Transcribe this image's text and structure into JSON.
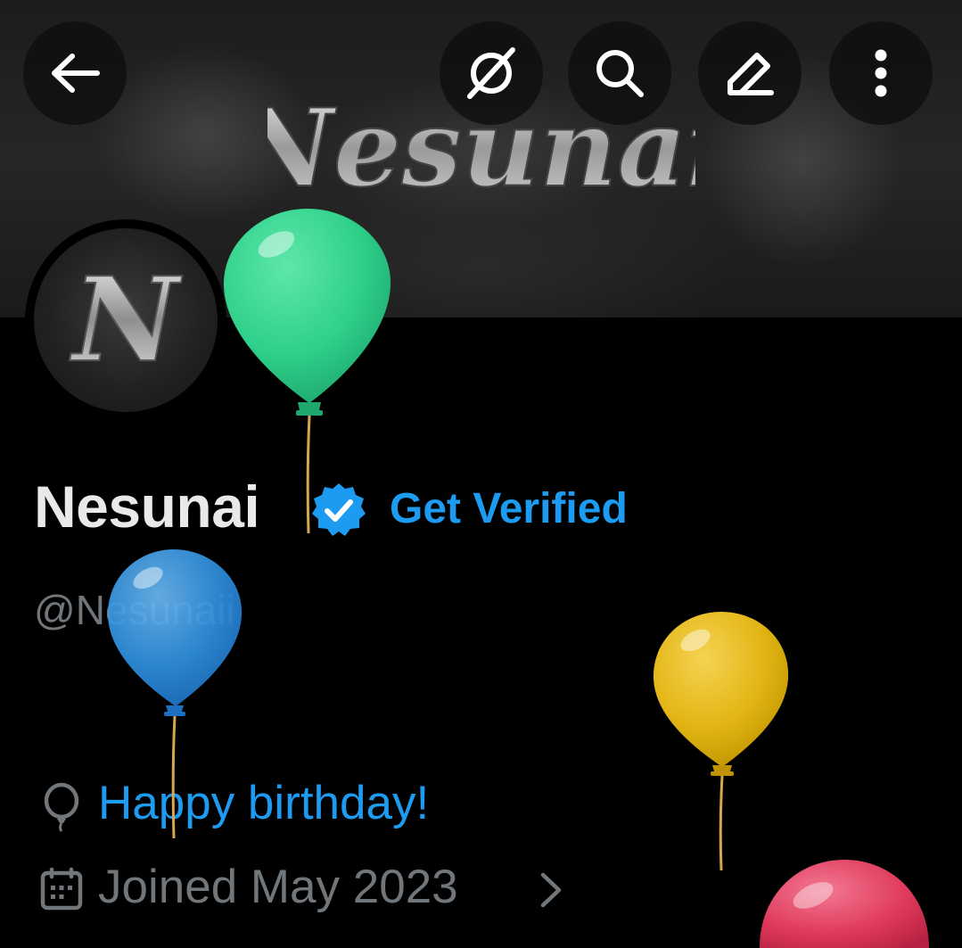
{
  "header": {
    "back_icon": "arrow-left-icon",
    "buttons": [
      {
        "icon": "grok-icon"
      },
      {
        "icon": "search-icon"
      },
      {
        "icon": "edit-icon"
      },
      {
        "icon": "more-vertical-icon"
      }
    ]
  },
  "banner": {
    "logo_text": "Nesunai"
  },
  "avatar": {
    "letter": "N"
  },
  "profile": {
    "display_name": "Nesunai",
    "verified_icon": "verified-badge-icon",
    "get_verified_label": "Get Verified",
    "handle": "@Nesunaii",
    "birthday_icon": "balloon-icon",
    "birthday_text": "Happy birthday!",
    "calendar_icon": "calendar-icon",
    "joined_text": "Joined May 2023",
    "joined_chevron": "chevron-right-icon"
  },
  "colors": {
    "accent": "#1d9bf0",
    "text": "#e7e9ea",
    "secondary": "#71767b",
    "balloon_green": "#2ed08a",
    "balloon_blue": "#2f8fdd",
    "balloon_yellow": "#e2b514",
    "balloon_red": "#e03a5c"
  }
}
